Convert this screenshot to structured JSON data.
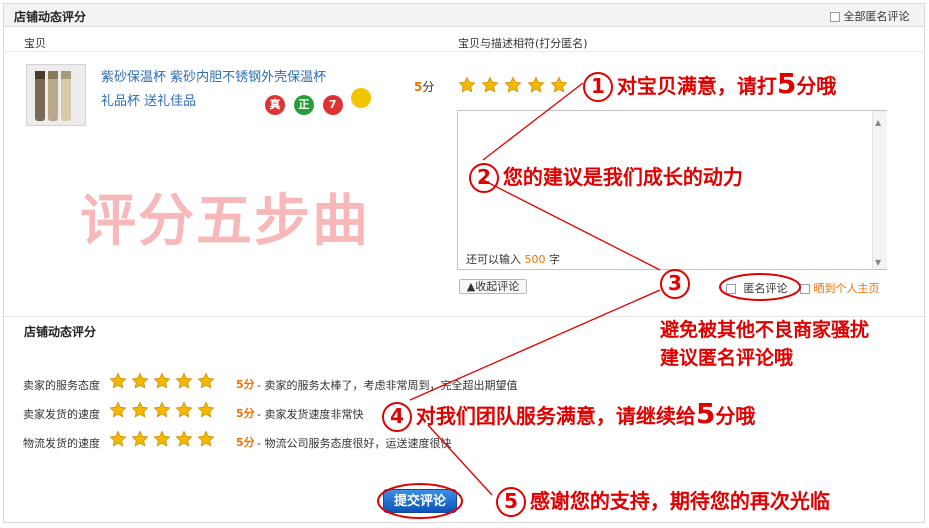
{
  "header": {
    "title": "店铺动态评分",
    "all_anonymous_label": "全部匿名评论"
  },
  "columns": {
    "item": "宝贝",
    "match": "宝贝与描述相符(打分匿名)"
  },
  "product": {
    "title_line1": "紫砂保温杯 紫砂内胆不锈钢外壳保温杯",
    "title_line2": "礼品杯 送礼佳品",
    "badges": [
      "真",
      "正",
      "7",
      ""
    ],
    "score": "5分",
    "rating": 5,
    "image_icon": "thermos-product-image"
  },
  "comment": {
    "remaining_prefix": "还可以输入",
    "remaining_count": "500",
    "remaining_suffix": "字"
  },
  "controls": {
    "collapse_label": "▲收起评论",
    "anonymous_label": "匿名评论",
    "share_label": "晒到个人主页"
  },
  "watermark": "评分五步曲",
  "shop_ratings": {
    "title": "店铺动态评分",
    "rows": [
      {
        "label": "卖家的服务态度",
        "score": "5分",
        "desc": "- 卖家的服务太棒了，考虑非常周到，完全超出期望值",
        "rating": 5
      },
      {
        "label": "卖家发货的速度",
        "score": "5分",
        "desc": "- 卖家发货速度非常快",
        "rating": 5
      },
      {
        "label": "物流发货的速度",
        "score": "5分",
        "desc": "- 物流公司服务态度很好，运送速度很快",
        "rating": 5
      }
    ]
  },
  "submit_label": "提交评论",
  "annotations": [
    {
      "num": "1",
      "text_a": "对宝贝满意，请打",
      "big": "5",
      "text_b": "分哦"
    },
    {
      "num": "2",
      "text_a": "您的建议是我们成长的动力",
      "big": "",
      "text_b": ""
    },
    {
      "num": "3",
      "text_a": "",
      "big": "",
      "text_b": ""
    },
    {
      "num": "4",
      "text_a": "对我们团队服务满意，请继续给",
      "big": "5",
      "text_b": "分哦"
    },
    {
      "num": "5",
      "text_a": "感谢您的支持，期待您的再次光临",
      "big": "",
      "text_b": ""
    }
  ],
  "annotation3_lines": [
    "避免被其他不良商家骚扰",
    "建议匿名评论哦"
  ],
  "colors": {
    "accent_red": "#e10000",
    "star_gold": "#f5b800",
    "link_blue": "#2d6db3",
    "orange": "#f07000"
  }
}
